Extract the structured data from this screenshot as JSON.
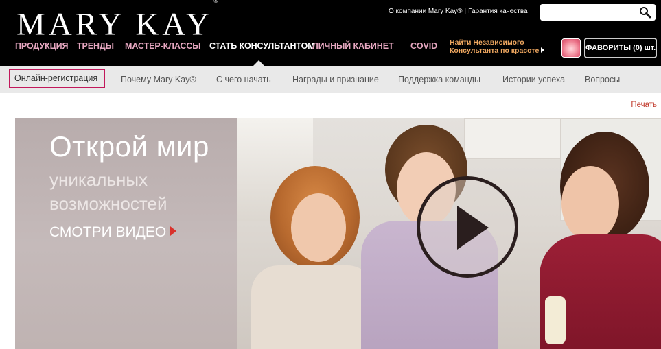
{
  "brand": {
    "logo_text": "MARY KAY",
    "logo_mark": "®"
  },
  "top_links": {
    "about": "О компании Mary Kay®",
    "separator": "|",
    "quality": "Гарантия качества"
  },
  "search": {
    "placeholder": "",
    "icon": "search-icon"
  },
  "main_nav": {
    "items": [
      {
        "label": "ПРОДУКЦИЯ"
      },
      {
        "label": "ТРЕНДЫ"
      },
      {
        "label": "МАСТЕР-КЛАССЫ"
      },
      {
        "label": "СТАТЬ КОНСУЛЬТАНТОМ",
        "active": true
      },
      {
        "label": "ЛИЧНЫЙ КАБИНЕТ"
      },
      {
        "label": "COVID"
      }
    ]
  },
  "find_consultant": {
    "line1": "Найти Независимого",
    "line2": "Консультанта по красоте"
  },
  "favorites": {
    "label": "ФАВОРИТЫ (0) шт."
  },
  "sub_nav": {
    "items": [
      {
        "label": "Онлайн-регистрация",
        "selected": true
      },
      {
        "label": "Почему Mary Kay®"
      },
      {
        "label": "С чего начать"
      },
      {
        "label": "Награды и признание"
      },
      {
        "label": "Поддержка команды"
      },
      {
        "label": "Истории успеха"
      },
      {
        "label": "Вопросы"
      }
    ]
  },
  "print_label": "Печать",
  "hero": {
    "title": "Открой мир",
    "subtitle_line1": "уникальных",
    "subtitle_line2": "возможностей",
    "cta": "СМОТРИ ВИДЕО"
  },
  "colors": {
    "header_bg": "#000000",
    "nav_pink": "#e6a7c0",
    "accent_red": "#d9322c",
    "selected_border": "#c2185b",
    "subnav_bg": "#e9e9e9"
  }
}
